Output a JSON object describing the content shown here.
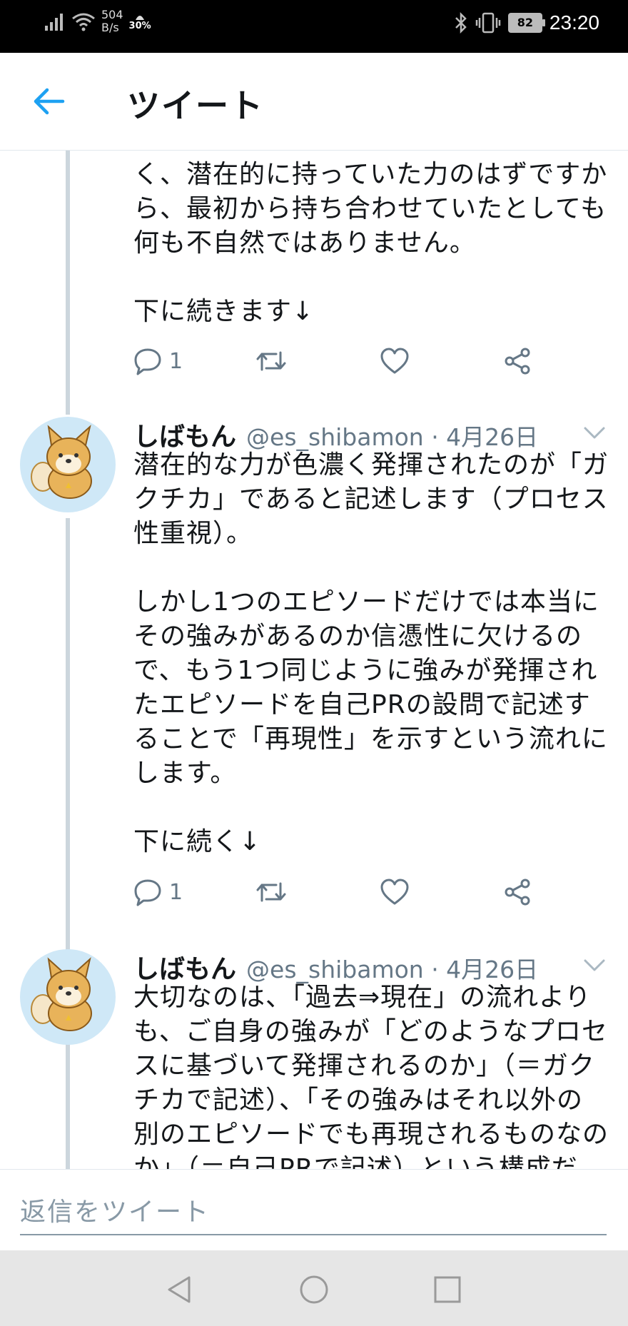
{
  "status_bar": {
    "net_speed_value": "504",
    "net_speed_unit": "B/s",
    "data_percent": "30%",
    "battery_level": "82",
    "time": "23:20"
  },
  "header": {
    "title": "ツイート"
  },
  "tweets": [
    {
      "text": "く、潜在的に持っていた力のはずですか\nら、最初から持ち合わせていたとしても\n何も不自然ではありません。\n\n下に続きます↓",
      "reply_count": "1"
    },
    {
      "name": "しばもん",
      "handle": "@es_shibamon · 4月26日",
      "text": "潜在的な力が色濃く発揮されたのが「ガ\nクチカ」であると記述します（プロセス\n性重視）。\n\nしかし1つのエピソードだけでは本当に\nその強みがあるのか信憑性に欠けるの\nで、もう1つ同じように強みが発揮され\nたエピソードを自己PRの設問で記述す\nることで「再現性」を示すという流れに\nします。\n\n下に続く↓",
      "reply_count": "1"
    },
    {
      "name": "しばもん",
      "handle": "@es_shibamon · 4月26日",
      "text": "大切なのは、「過去⇒現在」の流れより\nも、ご自身の強みが「どのようなプロセ\nスに基づいて発揮されるのか」（＝ガク\nチカで記述）、「その強みはそれ以外の\n別のエピソードでも再現されるものなの\nか」（＝自己PRで記述）という構成だ"
    }
  ],
  "reply_bar": {
    "placeholder": "返信をツイート"
  },
  "colors": {
    "accent": "#1da1f2",
    "icon_gray": "#657786",
    "thread_line": "#ccd6dd",
    "avatar_bg": "#cfe8f7"
  },
  "icons": [
    "signal-icon",
    "wifi-icon",
    "data-icon",
    "bluetooth-icon",
    "vibrate-icon",
    "battery-icon",
    "back-arrow-icon",
    "reply-icon",
    "retweet-icon",
    "like-icon",
    "share-icon",
    "chevron-down-icon",
    "nav-back-icon",
    "nav-home-icon",
    "nav-recents-icon"
  ]
}
